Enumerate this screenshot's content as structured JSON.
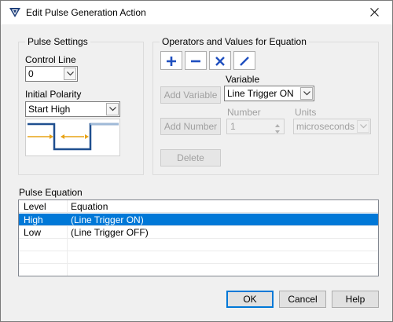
{
  "window": {
    "title": "Edit Pulse Generation Action"
  },
  "pulse_settings": {
    "group_title": "Pulse Settings",
    "control_line_label": "Control Line",
    "control_line_value": "0",
    "initial_polarity_label": "Initial Polarity",
    "initial_polarity_value": "Start High"
  },
  "operators": {
    "group_title": "Operators and Values for Equation",
    "variable_label": "Variable",
    "variable_value": "Line Trigger ON",
    "add_variable_label": "Add Variable",
    "number_label": "Number",
    "number_value": "1",
    "units_label": "Units",
    "units_value": "microseconds",
    "add_number_label": "Add Number",
    "delete_label": "Delete"
  },
  "pulse_equation": {
    "label": "Pulse Equation",
    "columns": [
      "Level",
      "Equation"
    ],
    "rows": [
      {
        "level": "High",
        "equation": "(Line Trigger ON)"
      },
      {
        "level": "Low",
        "equation": "(Line Trigger OFF)"
      }
    ]
  },
  "footer": {
    "ok_label": "OK",
    "cancel_label": "Cancel",
    "help_label": "Help"
  },
  "colors": {
    "selection": "#0078d7",
    "operator_blue": "#1f4fbf",
    "pulse_arrow": "#e8a317",
    "pulse_line": "#1f4f8f"
  }
}
